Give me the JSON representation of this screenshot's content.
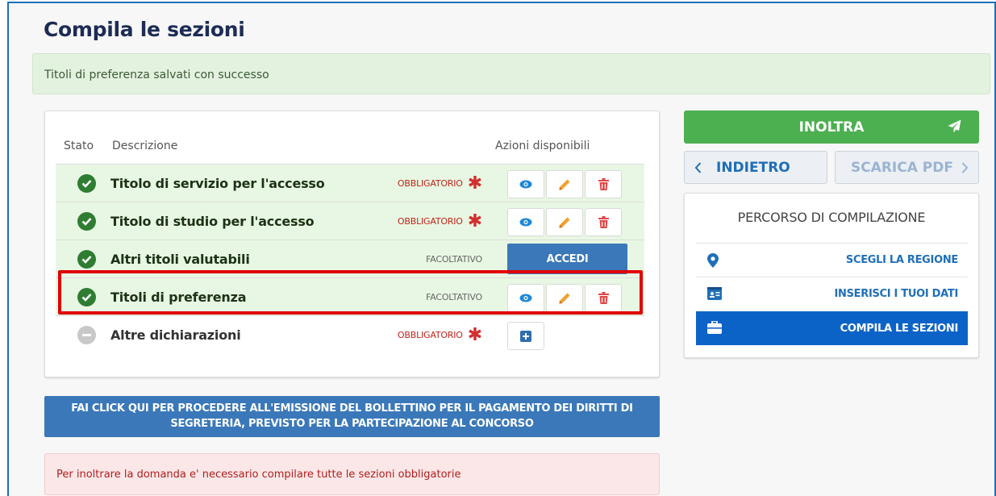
{
  "page_title": "Compila le sezioni",
  "success_message": "Titoli di preferenza salvati con successo",
  "table": {
    "headers": {
      "status": "Stato",
      "description": "Descrizione",
      "actions": "Azioni disponibili"
    },
    "rows": [
      {
        "label": "Titolo di servizio per l'accesso",
        "requirement": "OBBLIGATORIO",
        "state": "completed"
      },
      {
        "label": "Titolo di studio per l'accesso",
        "requirement": "OBBLIGATORIO",
        "state": "completed"
      },
      {
        "label": "Altri titoli valutabili",
        "requirement": "FACOLTATIVO",
        "state": "completed",
        "action_label": "ACCEDI"
      },
      {
        "label": "Titoli di preferenza",
        "requirement": "FACOLTATIVO",
        "state": "completed"
      },
      {
        "label": "Altre dichiarazioni",
        "requirement": "OBBLIGATORIO",
        "state": "pending"
      }
    ]
  },
  "payment_button": {
    "line1": "FAI CLICK QUI PER PROCEDERE ALL'EMISSIONE DEL BOLLETTINO PER IL PAGAMENTO DEI DIRITTI DI",
    "line2": "SEGRETERIA, PREVISTO PER LA PARTECIPAZIONE AL CONCORSO"
  },
  "error_message": "Per inoltrare la domanda e' necessario compilare tutte le sezioni obbligatorie",
  "sidebar": {
    "submit_label": "INOLTRA",
    "back_label": "INDIETRO",
    "pdf_label": "SCARICA PDF",
    "progress_title": "PERCORSO DI COMPILAZIONE",
    "steps": [
      {
        "label": "SCEGLI LA REGIONE",
        "icon": "map-pin-icon",
        "active": false
      },
      {
        "label": "INSERISCI I TUOI DATI",
        "icon": "id-card-icon",
        "active": false
      },
      {
        "label": "COMPILA LE SEZIONI",
        "icon": "briefcase-icon",
        "active": true
      }
    ]
  },
  "colors": {
    "title": "#1d2c55",
    "primary_blue": "#3a78b9",
    "success_green": "#4caf50",
    "completed_row_bg": "#e8f7e3",
    "mandatory_red": "#c0251a",
    "highlight_red": "#e00000"
  }
}
